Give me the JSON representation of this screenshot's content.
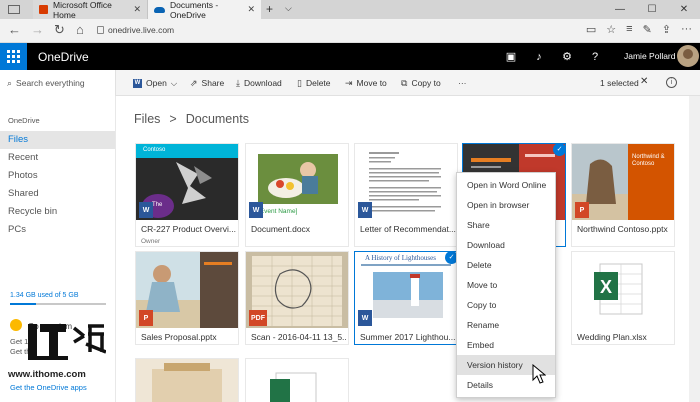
{
  "browser": {
    "tabs": [
      {
        "label": "Microsoft Office Home",
        "active": false
      },
      {
        "label": "Documents - OneDrive",
        "active": true
      }
    ],
    "url": "onedrive.live.com",
    "new_tab_symbol": "+",
    "window_controls": [
      "—",
      "☐",
      "✕"
    ]
  },
  "header": {
    "app_name": "OneDrive",
    "user_name": "Jamie Pollard",
    "icons": [
      "chat-icon",
      "bell-icon",
      "gear-icon",
      "help-icon"
    ],
    "accent_color": "#0078d7"
  },
  "commandbar": {
    "search_placeholder": "Search everything",
    "commands": [
      {
        "name": "open",
        "label": "Open",
        "chevron": "⌵"
      },
      {
        "name": "share",
        "label": "Share"
      },
      {
        "name": "download",
        "label": "Download"
      },
      {
        "name": "delete",
        "label": "Delete"
      },
      {
        "name": "move-to",
        "label": "Move to"
      },
      {
        "name": "copy-to",
        "label": "Copy to"
      },
      {
        "name": "more",
        "label": "···"
      }
    ],
    "selection_count": "1 selected"
  },
  "sidebar": {
    "section": "OneDrive",
    "items": [
      {
        "label": "Files",
        "selected": true
      },
      {
        "label": "Recent",
        "selected": false
      },
      {
        "label": "Photos",
        "selected": false
      },
      {
        "label": "Shared",
        "selected": false
      },
      {
        "label": "Recycle bin",
        "selected": false
      },
      {
        "label": "PCs",
        "selected": false
      }
    ],
    "storage": "1.34 GB used of 5 GB",
    "storage_used_fraction": 0.268,
    "premium_title": "Go premium",
    "premium_desc_lines": [
      "Get 1",
      "Get the"
    ],
    "apps_link": "Get the OneDrive apps"
  },
  "watermark": {
    "logo_text": "IT之家",
    "url": "www.ithome.com"
  },
  "breadcrumb": [
    "Files",
    "Documents"
  ],
  "breadcrumb_sep": ">",
  "files": [
    {
      "name": "CR-227 Product Overvi...",
      "type": "word",
      "sub": "Owner",
      "badge": "W",
      "thumb_title": "Contoso",
      "thumb_sub": "The"
    },
    {
      "name": "Document.docx",
      "type": "word",
      "badge": "W",
      "thumb_caption": "[Event Name]"
    },
    {
      "name": "Letter of Recommendat...",
      "type": "word",
      "badge": "W"
    },
    {
      "name": "",
      "type": "powerpoint",
      "badge": "P",
      "selected": true
    },
    {
      "name": "Northwind Contoso.pptx",
      "type": "powerpoint",
      "badge": "P",
      "thumb_title": "Northwind & Contoso"
    },
    {
      "name": "Sales Proposal.pptx",
      "type": "powerpoint",
      "badge": "P"
    },
    {
      "name": "Scan - 2016-04-11 13_5...",
      "type": "pdf",
      "badge": "PDF"
    },
    {
      "name": "Summer 2017 Lighthou...",
      "type": "word",
      "badge": "W",
      "thumb_title": "A History of Lighthouses",
      "selected": true
    },
    {
      "name": "",
      "type": "hidden"
    },
    {
      "name": "Wedding Plan.xlsx",
      "type": "excel",
      "badge": "X"
    }
  ],
  "context_menu": [
    {
      "label": "Open in Word Online"
    },
    {
      "label": "Open in browser"
    },
    {
      "label": "Share"
    },
    {
      "label": "Download"
    },
    {
      "label": "Delete"
    },
    {
      "label": "Move to"
    },
    {
      "label": "Copy to"
    },
    {
      "label": "Rename"
    },
    {
      "label": "Embed"
    },
    {
      "label": "Version history",
      "hover": true
    },
    {
      "label": "Details"
    }
  ]
}
